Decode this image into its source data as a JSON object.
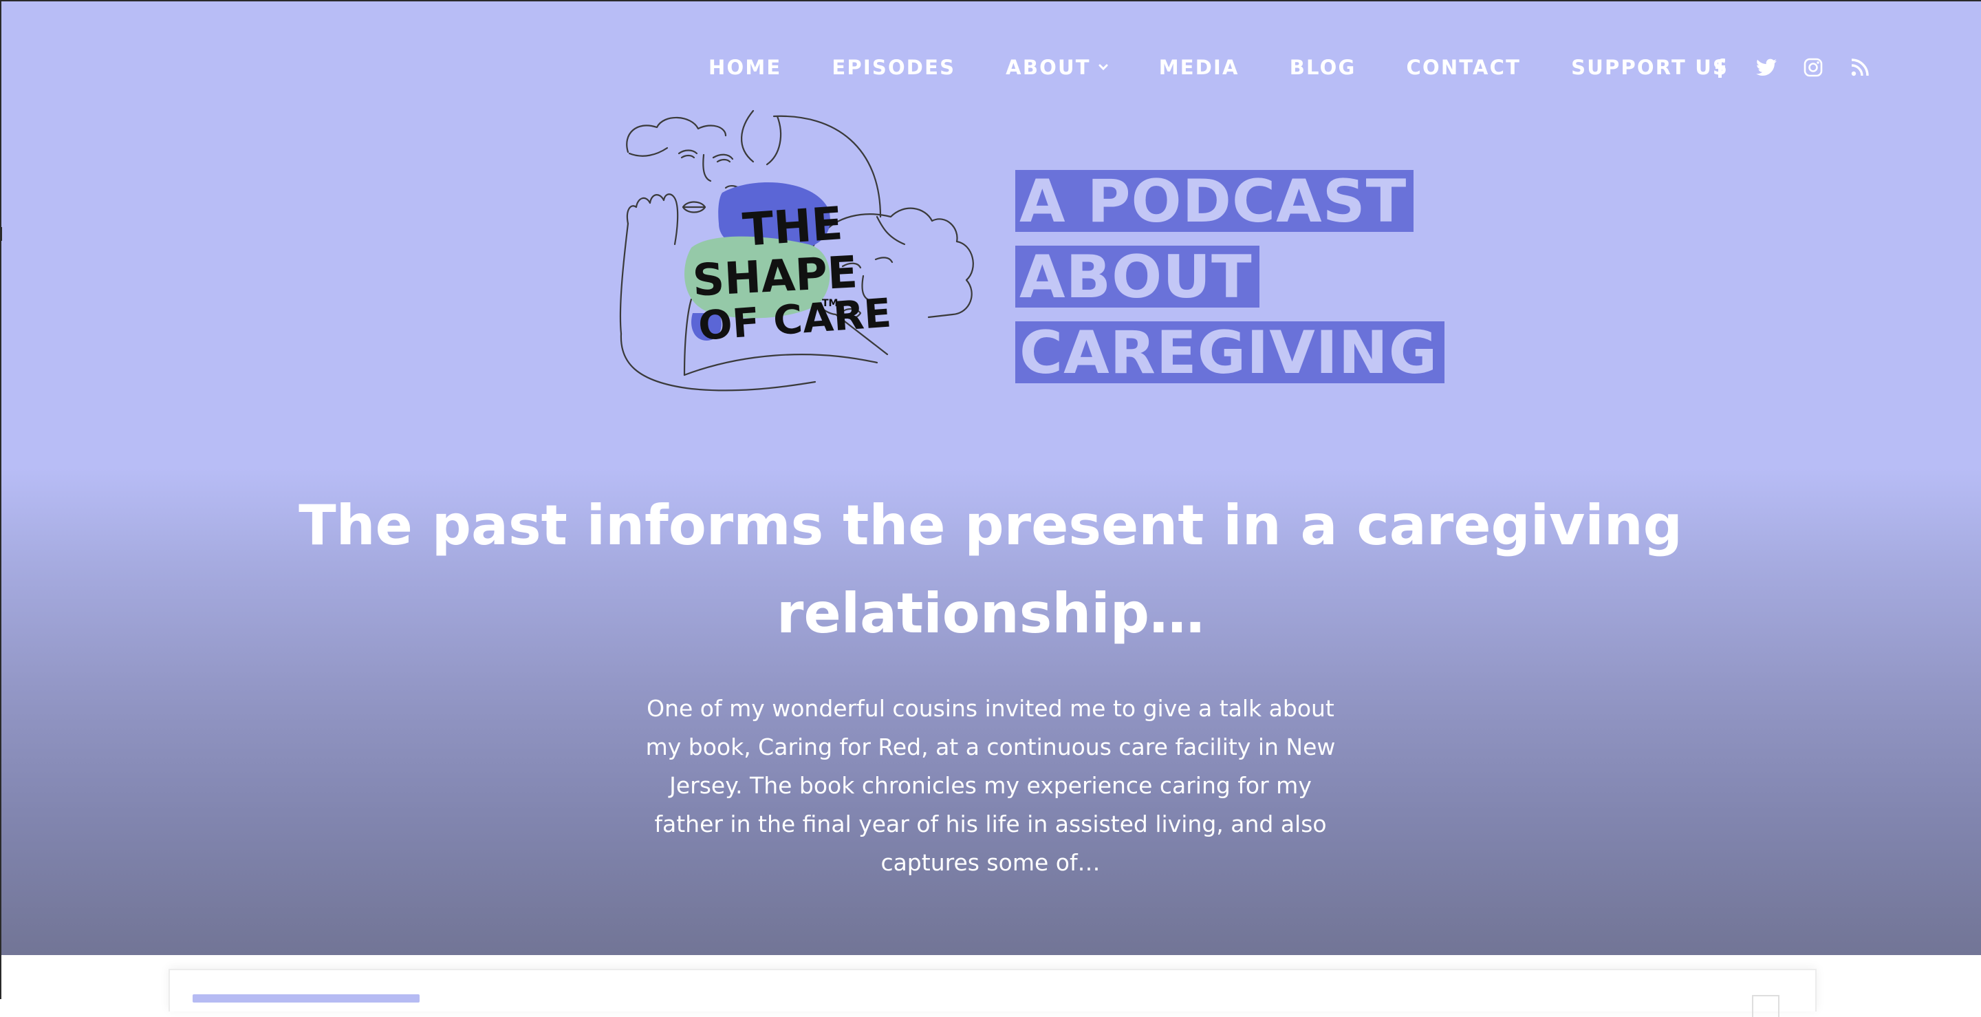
{
  "nav": {
    "items": [
      {
        "label": "HOME"
      },
      {
        "label": "EPISODES"
      },
      {
        "label": "ABOUT"
      },
      {
        "label": "MEDIA"
      },
      {
        "label": "BLOG"
      },
      {
        "label": "CONTACT"
      },
      {
        "label": "SUPPORT US"
      }
    ],
    "social": [
      "facebook-icon",
      "twitter-icon",
      "instagram-icon",
      "rss-icon"
    ]
  },
  "logo": {
    "title_lines": [
      "THE",
      "SHAPE",
      "OF CARE"
    ],
    "trademark": "TM",
    "tagline": [
      "A PODCAST",
      "ABOUT",
      "CAREGIVING"
    ]
  },
  "post": {
    "headline": "The past informs the present in a caregiving relationship…",
    "excerpt": "One of my wonderful cousins invited me to give a talk about my book, Caring for Red, at a continuous care facility in New Jersey. The book chronicles my experience caring for my father in the final year of his life in assisted living, and also captures some of…"
  },
  "colors": {
    "hero_top": "#b8bdf6",
    "hero_bottom": "#727596",
    "tagline_bg": "#6a72d9",
    "tagline_text": "#c3c7f6",
    "logo_blue": "#5b66d6",
    "logo_green": "#95c9a8"
  }
}
